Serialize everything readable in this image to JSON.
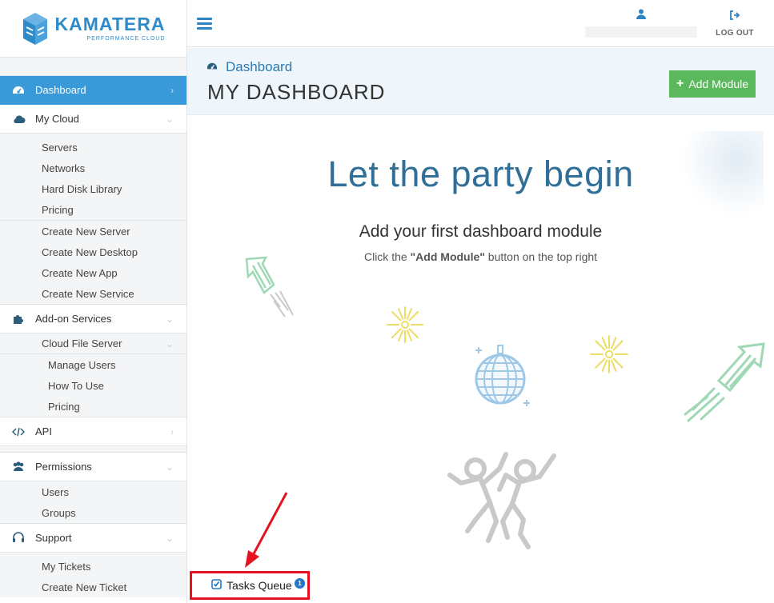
{
  "brand": {
    "name": "KAMATERA",
    "tagline": "PERFORMANCE CLOUD",
    "color": "#2d8bc9"
  },
  "sidebar": {
    "dashboard": {
      "label": "Dashboard",
      "icon": "dashboard-gauge-icon",
      "active": true
    },
    "my_cloud": {
      "label": "My Cloud",
      "icon": "cloud-icon",
      "items": [
        "Servers",
        "Networks",
        "Hard Disk Library",
        "Pricing"
      ],
      "create_items": [
        "Create New Server",
        "Create New Desktop",
        "Create New App",
        "Create New Service"
      ]
    },
    "addon": {
      "label": "Add-on Services",
      "icon": "puzzle-icon",
      "cloud_file_server": {
        "label": "Cloud File Server",
        "items": [
          "Manage Users",
          "How To Use",
          "Pricing"
        ]
      }
    },
    "api": {
      "label": "API",
      "icon": "code-icon"
    },
    "permissions": {
      "label": "Permissions",
      "icon": "users-icon",
      "items": [
        "Users",
        "Groups"
      ]
    },
    "support": {
      "label": "Support",
      "icon": "headset-icon",
      "items": [
        "My Tickets",
        "Create New Ticket"
      ]
    }
  },
  "header": {
    "logout_label": "LOG OUT"
  },
  "titlebar": {
    "breadcrumb": "Dashboard",
    "page_title": "MY DASHBOARD",
    "add_module_label": "Add Module"
  },
  "main": {
    "headline": "Let the party begin",
    "subheadline": "Add your first dashboard module",
    "hint_pre": "Click the ",
    "hint_bold": "\"Add Module\"",
    "hint_post": " button on the top right"
  },
  "tasks_queue": {
    "label": "Tasks Queue",
    "count": "1"
  },
  "colors": {
    "accent": "#3a9ad9",
    "add_button": "#5cb85c",
    "highlight_box": "#e5121f",
    "headline": "#2f6f98"
  }
}
